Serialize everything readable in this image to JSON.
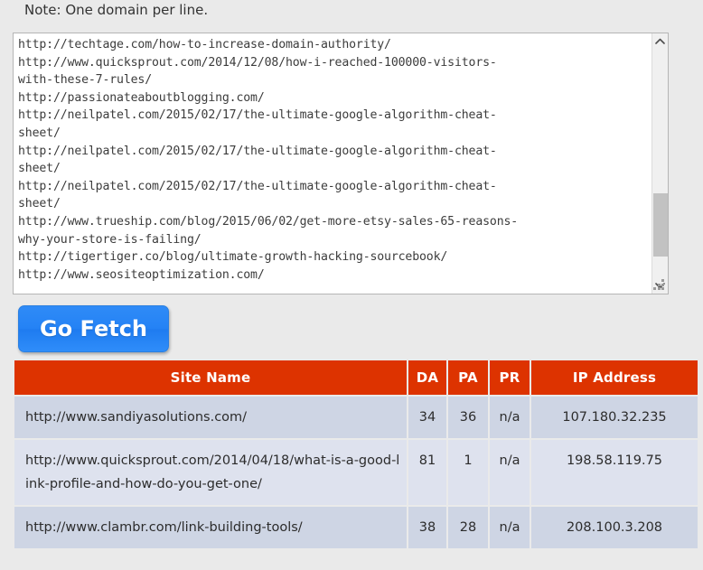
{
  "note": "Note: One domain per line.",
  "domain_input": {
    "value": "http://techtage.com/how-to-increase-domain-authority/\nhttp://www.quicksprout.com/2014/12/08/how-i-reached-100000-visitors-\nwith-these-7-rules/\nhttp://passionateaboutblogging.com/\nhttp://neilpatel.com/2015/02/17/the-ultimate-google-algorithm-cheat-\nsheet/\nhttp://neilpatel.com/2015/02/17/the-ultimate-google-algorithm-cheat-\nsheet/\nhttp://neilpatel.com/2015/02/17/the-ultimate-google-algorithm-cheat-\nsheet/\nhttp://www.trueship.com/blog/2015/06/02/get-more-etsy-sales-65-reasons-\nwhy-your-store-is-failing/\nhttp://tigertiger.co/blog/ultimate-growth-hacking-sourcebook/\nhttp://www.seositeoptimization.com/",
    "placeholder": ""
  },
  "fetch_button": {
    "label": "Go Fetch"
  },
  "results_table": {
    "columns": [
      "Site Name",
      "DA",
      "PA",
      "PR",
      "IP Address"
    ],
    "rows": [
      {
        "site": "http://www.sandiyasolutions.com/",
        "da": "34",
        "pa": "36",
        "pr": "n/a",
        "ip": "107.180.32.235"
      },
      {
        "site": "http://www.quicksprout.com/2014/04/18/what-is-a-good-link-profile-and-how-do-you-get-one/",
        "da": "81",
        "pa": "1",
        "pr": "n/a",
        "ip": "198.58.119.75"
      },
      {
        "site": "http://www.clambr.com/link-building-tools/",
        "da": "38",
        "pa": "28",
        "pr": "n/a",
        "ip": "208.100.3.208"
      }
    ]
  },
  "colors": {
    "page_background": "#eaeaea",
    "header_accent": "#dd3300",
    "button_blue": "#2482f5",
    "row_odd": "#ced5e4",
    "row_even": "#dee2ee"
  }
}
